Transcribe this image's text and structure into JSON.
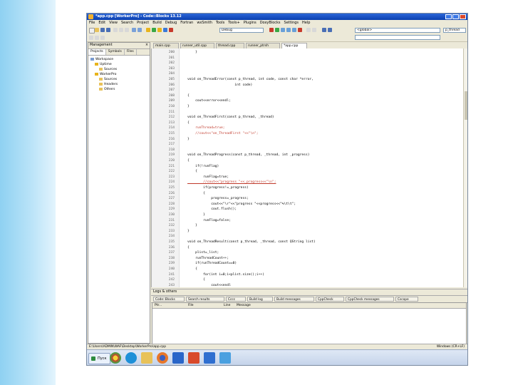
{
  "window": {
    "title": "*app.cpp [WorkerPro] - Code::Blocks 13.12"
  },
  "menu": [
    "File",
    "Edit",
    "View",
    "Search",
    "Project",
    "Build",
    "Debug",
    "Fortran",
    "wxSmith",
    "Tools",
    "Tools+",
    "Plugins",
    "DoxyBlocks",
    "Settings",
    "Help"
  ],
  "toolbar": {
    "build_target": "Debug",
    "symbol_combo": "<global>",
    "right_combo": "p_thread"
  },
  "management": {
    "title": "Management",
    "tabs": [
      "Projects",
      "Symbols",
      "Files"
    ],
    "tree": [
      {
        "label": "Workspace",
        "level": 0
      },
      {
        "label": "Uptime",
        "level": 1
      },
      {
        "label": "Sources",
        "level": 2
      },
      {
        "label": "WorkerPro",
        "level": 1
      },
      {
        "label": "Sources",
        "level": 2
      },
      {
        "label": "Headers",
        "level": 2
      },
      {
        "label": "Others",
        "level": 2
      }
    ]
  },
  "editor": {
    "tabs": [
      "main.cpp",
      "runner_util.cpp",
      "thread.cpp",
      "runner_ptrsh",
      "*app.cpp"
    ],
    "lines": [
      {
        "n": "200",
        "text": "    }",
        "kind": "code"
      },
      {
        "n": "201",
        "text": "",
        "kind": "code"
      },
      {
        "n": "202",
        "text": "",
        "kind": "code"
      },
      {
        "n": "203",
        "text": "",
        "kind": "code"
      },
      {
        "n": "204",
        "text": "",
        "kind": "code"
      },
      {
        "n": "205",
        "text": "void on_ThreadError(const p_thread, int code, const char *error,",
        "kind": "code"
      },
      {
        "n": "206",
        "text": "                        int code)",
        "kind": "code"
      },
      {
        "n": "207",
        "text": "",
        "kind": "code"
      },
      {
        "n": "208",
        "text": "{",
        "kind": "code"
      },
      {
        "n": "209",
        "text": "    cout<<error<<endl;",
        "kind": "code"
      },
      {
        "n": "210",
        "text": "}",
        "kind": "code"
      },
      {
        "n": "211",
        "text": "",
        "kind": "code"
      },
      {
        "n": "212",
        "text": "void on_ThreadFirst(const p_thread, _thread)",
        "kind": "code"
      },
      {
        "n": "213",
        "text": "{",
        "kind": "code"
      },
      {
        "n": "214",
        "text": "    runThread=true;",
        "kind": "comment"
      },
      {
        "n": "215",
        "text": "    //cout<<\"on_ThreadFirst \"<<\"\\n\";",
        "kind": "comment"
      },
      {
        "n": "216",
        "text": "}",
        "kind": "code"
      },
      {
        "n": "217",
        "text": "",
        "kind": "code"
      },
      {
        "n": "218",
        "text": "",
        "kind": "code"
      },
      {
        "n": "219",
        "text": "void on_ThreadProgress(const p_thread, _thread, int _progress)",
        "kind": "code"
      },
      {
        "n": "220",
        "text": "{",
        "kind": "code"
      },
      {
        "n": "221",
        "text": "    if(!runFlag)",
        "kind": "code"
      },
      {
        "n": "222",
        "text": "    {",
        "kind": "code"
      },
      {
        "n": "223",
        "text": "        runFlag=true;",
        "kind": "code"
      },
      {
        "n": "224",
        "text": "        //cout<<\"progress \"<<_progress<<\"\\n\";",
        "kind": "comment2"
      },
      {
        "n": "225",
        "text": "        if(progress!=_progress)",
        "kind": "code"
      },
      {
        "n": "226",
        "text": "        {",
        "kind": "code"
      },
      {
        "n": "227",
        "text": "            progress=_progress;",
        "kind": "code"
      },
      {
        "n": "228",
        "text": "            cout<<\"\\r\"<<\"progress \"<<progress<<\"%\\t\\t\";",
        "kind": "code"
      },
      {
        "n": "229",
        "text": "            cout.flush();",
        "kind": "code"
      },
      {
        "n": "230",
        "text": "        }",
        "kind": "code"
      },
      {
        "n": "231",
        "text": "        runFlag=false;",
        "kind": "code"
      },
      {
        "n": "232",
        "text": "    }",
        "kind": "code"
      },
      {
        "n": "233",
        "text": "}",
        "kind": "code"
      },
      {
        "n": "234",
        "text": "",
        "kind": "code"
      },
      {
        "n": "235",
        "text": "void on_ThreadResult(const p_thread, _thread, const QString list)",
        "kind": "code"
      },
      {
        "n": "236",
        "text": "{",
        "kind": "code"
      },
      {
        "n": "237",
        "text": "    plist=_list;",
        "kind": "code"
      },
      {
        "n": "238",
        "text": "    runThreadCount++;",
        "kind": "code"
      },
      {
        "n": "239",
        "text": "    if(runThreadCount==0)",
        "kind": "code"
      },
      {
        "n": "240",
        "text": "    {",
        "kind": "code"
      },
      {
        "n": "241",
        "text": "        for(int i=0;i<plist.size();i++)",
        "kind": "code"
      },
      {
        "n": "242",
        "text": "        {",
        "kind": "code"
      },
      {
        "n": "243",
        "text": "            cout<<endl",
        "kind": "code"
      }
    ]
  },
  "logs": {
    "title": "Logs & others",
    "tabs": [
      "Code::Blocks",
      "Search results",
      "Cccc",
      "Build log",
      "Build messages",
      "CppCheck",
      "CppCheck messages",
      "Cscope"
    ],
    "columns": [
      "File",
      "Line",
      "Message"
    ],
    "first_column": "Ptr..."
  },
  "statusbar": {
    "path": "E:\\Users\\ADMIN\\WAF\\Desktop\\WorkerPro\\app.cpp",
    "right": "Windows (CR+LF)"
  },
  "taskbar": {
    "start_label": "Пуск"
  }
}
